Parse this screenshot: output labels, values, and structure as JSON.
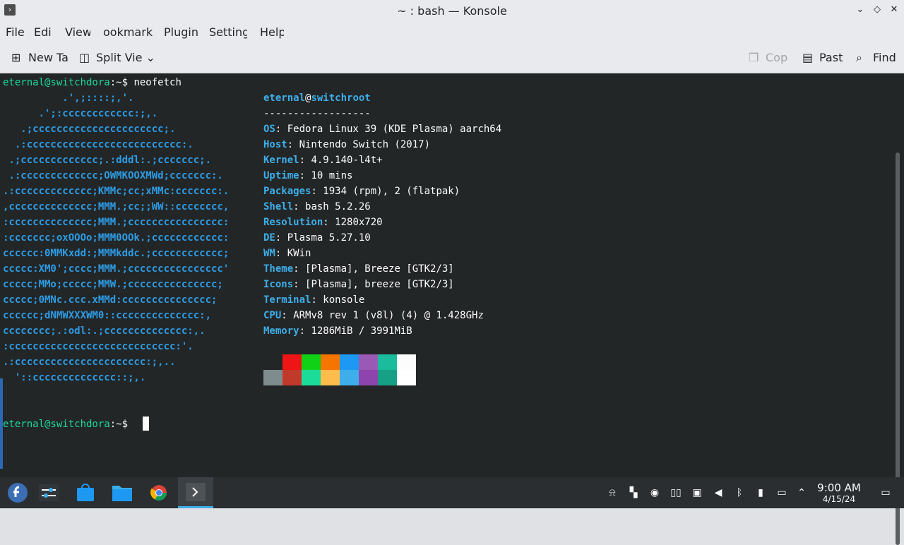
{
  "window": {
    "title": "~ : bash — Konsole",
    "app_icon": "terminal-icon"
  },
  "menu": [
    "File",
    "Edit",
    "View",
    "Bookmarks",
    "Plugins",
    "Settings",
    "Help"
  ],
  "menu_visible": [
    "File",
    "Edi",
    "View",
    "ookmark",
    "Plugin",
    "Setting",
    "Help"
  ],
  "toolbar": {
    "new_tab": "New Ta",
    "split_view": "Split Vie",
    "copy": "Cop",
    "paste": "Past",
    "find": "Find"
  },
  "terminal": {
    "prompt_user": "eternal@switchdora",
    "prompt_path": ":~$ ",
    "command": "neofetch",
    "logo_lines": [
      "          .',;::::;,'.",
      "      .';:cccccccccccc:;,.",
      "   .;cccccccccccccccccccccc;.",
      "  .:cccccccccccccccccccccccccc:.",
      " .;ccccccccccccc;.:dddl:.;ccccccc;.",
      " .:ccccccccccccc;OWMKOOXMWd;ccccccc:.",
      ".:ccccccccccccc;KMMc;cc;xMMc:ccccccc:.",
      ",cccccccccccccc;MMM.;cc;;WW::cccccccc,",
      ":cccccccccccccc;MMM.;cccccccccccccccc:",
      ":ccccccc;oxOOOo;MMM0OOk.;cccccccccccc:",
      "cccccc:0MMKxdd:;MMMkddc.;cccccccccccc;",
      "ccccc:XM0';cccc;MMM.;cccccccccccccccc'",
      "ccccc;MMo;ccccc;MMW.;ccccccccccccccc;",
      "ccccc;0MNc.ccc.xMMd:ccccccccccccccc;",
      "cccccc;dNMWXXXWM0::cccccccccccccc:,",
      "cccccccc;.:odl:.;cccccccccccccc:,.",
      ":cccccccccccccccccccccccccccc:'.",
      ".:cccccccccccccccccccccc:;,..",
      "  '::cccccccccccccc::;,."
    ],
    "info_header_user": "eternal",
    "info_header_at": "@",
    "info_header_host": "switchroot",
    "separator": "------------------",
    "info": [
      {
        "key": "OS",
        "value": "Fedora Linux 39 (KDE Plasma) aarch64"
      },
      {
        "key": "Host",
        "value": "Nintendo Switch (2017)"
      },
      {
        "key": "Kernel",
        "value": "4.9.140-l4t+"
      },
      {
        "key": "Uptime",
        "value": "10 mins"
      },
      {
        "key": "Packages",
        "value": "1934 (rpm), 2 (flatpak)"
      },
      {
        "key": "Shell",
        "value": "bash 5.2.26"
      },
      {
        "key": "Resolution",
        "value": "1280x720"
      },
      {
        "key": "DE",
        "value": "Plasma 5.27.10"
      },
      {
        "key": "WM",
        "value": "KWin"
      },
      {
        "key": "Theme",
        "value": "[Plasma], Breeze [GTK2/3]"
      },
      {
        "key": "Icons",
        "value": "[Plasma], breeze [GTK2/3]"
      },
      {
        "key": "Terminal",
        "value": "konsole"
      },
      {
        "key": "CPU",
        "value": "ARMv8 rev 1 (v8l) (4) @ 1.428GHz"
      },
      {
        "key": "Memory",
        "value": "1286MiB / 3991MiB"
      }
    ],
    "palette_top": [
      "#232627",
      "#ed1515",
      "#11d116",
      "#f67400",
      "#1d99f3",
      "#9b59b6",
      "#1abc9c",
      "#fcfcfc"
    ],
    "palette_bottom": [
      "#7f8c8d",
      "#c0392b",
      "#1cdc9a",
      "#fdbc4b",
      "#3daee9",
      "#8e44ad",
      "#16a085",
      "#ffffff"
    ]
  },
  "taskbar": {
    "apps": [
      "fedora-launcher-icon",
      "system-settings-icon",
      "discover-store-icon",
      "file-manager-icon",
      "chrome-icon",
      "konsole-icon"
    ],
    "tray": [
      "notifications-icon",
      "widgets-icon",
      "updates-icon",
      "switch-controller-icon",
      "storage-icon",
      "volume-icon",
      "bluetooth-icon",
      "usb-icon",
      "network-icon",
      "tray-expand-icon"
    ],
    "time": "9:00 AM",
    "date": "4/15/24"
  }
}
